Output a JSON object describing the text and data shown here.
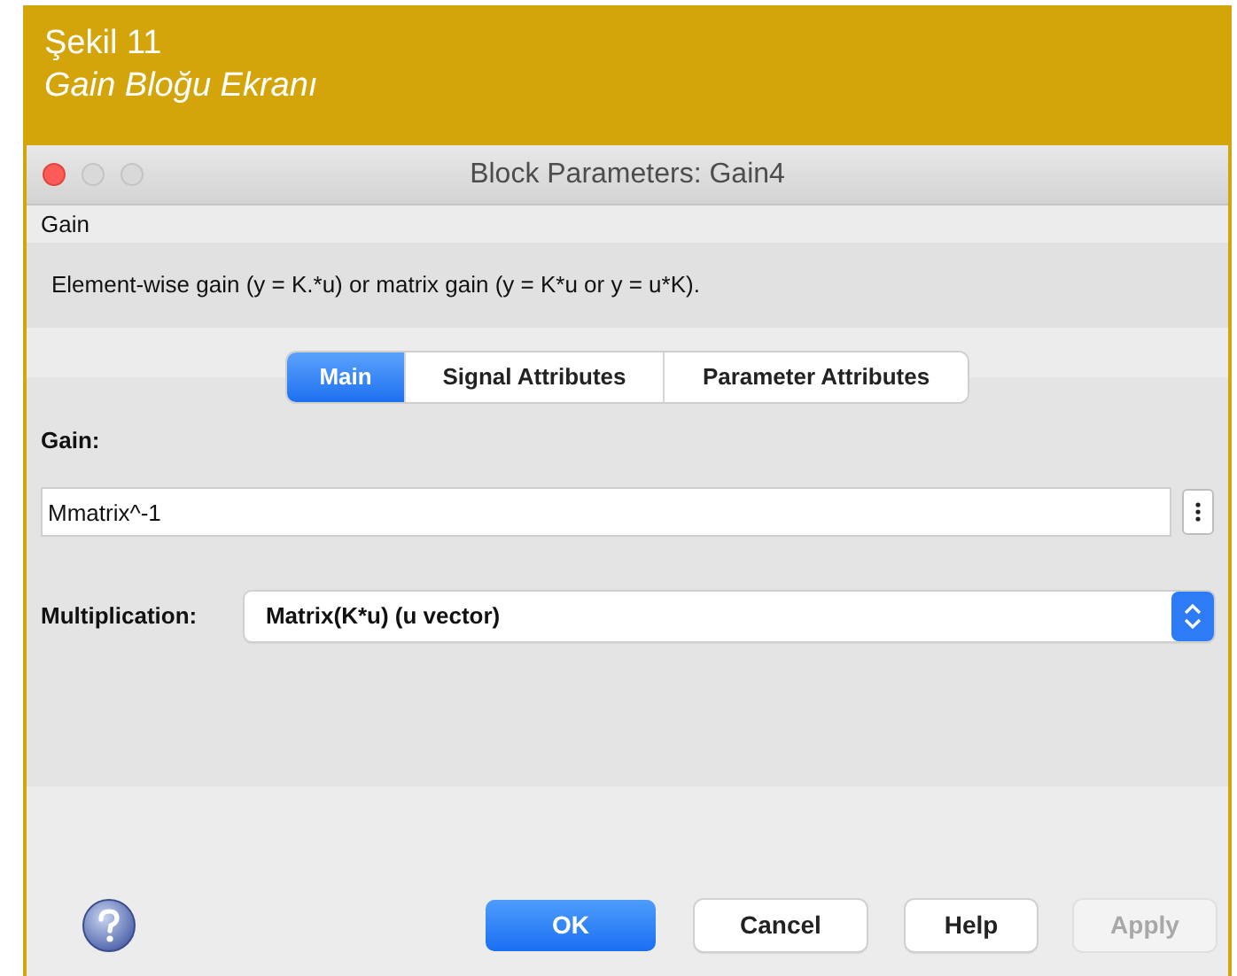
{
  "caption": {
    "number": "Şekil 11",
    "title": "Gain Bloğu Ekranı"
  },
  "window": {
    "title": "Block Parameters: Gain4"
  },
  "block_type": "Gain",
  "description": "Element-wise gain (y = K.*u) or matrix gain (y = K*u or y = u*K).",
  "tabs": [
    {
      "label": "Main",
      "selected": true
    },
    {
      "label": "Signal Attributes",
      "selected": false
    },
    {
      "label": "Parameter Attributes",
      "selected": false
    }
  ],
  "gain": {
    "label": "Gain:",
    "value": "Mmatrix^-1"
  },
  "multiplication": {
    "label": "Multiplication:",
    "value": "Matrix(K*u) (u vector)"
  },
  "buttons": [
    {
      "label": "OK",
      "kind": "default",
      "disabled": false
    },
    {
      "label": "Cancel",
      "kind": "normal",
      "disabled": false
    },
    {
      "label": "Help",
      "kind": "normal",
      "disabled": false
    },
    {
      "label": "Apply",
      "kind": "normal",
      "disabled": true
    }
  ]
}
